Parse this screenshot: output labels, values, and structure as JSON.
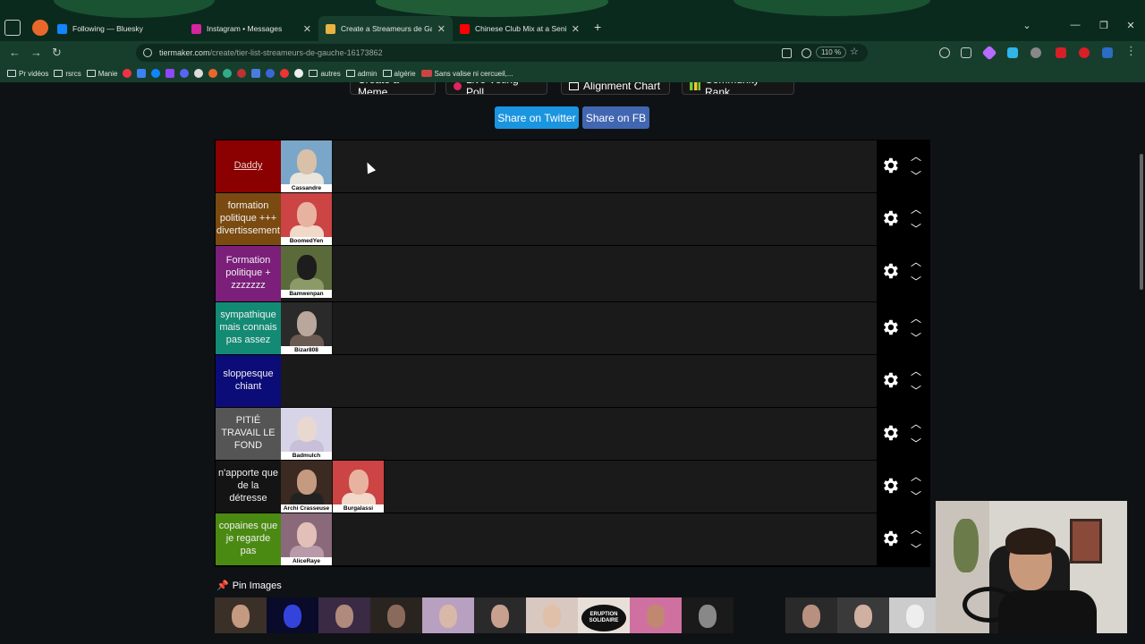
{
  "browser": {
    "tabs": [
      {
        "title": "Following — Bluesky",
        "color": "#1185fe"
      },
      {
        "title": "Instagram • Messages",
        "color": "#d6249f"
      },
      {
        "title": "Create a Streameurs de Gauche",
        "color": "#e8b341",
        "active": true
      },
      {
        "title": "Chinese Club Mix at a Senior",
        "color": "#ff0000"
      }
    ],
    "url_host": "tiermaker.com",
    "url_path": "/create/tier-list-streameurs-de-gauche-16173862",
    "zoom": "110 %",
    "bookmarks": [
      "Pr vidéos",
      "rsrcs",
      "Manie",
      "autres",
      "admin",
      "algérie",
      "Sans valise ni cercueil,..."
    ]
  },
  "page": {
    "top_buttons": [
      "Create a Meme",
      "Live Voting Poll",
      "Alignment Chart",
      "Community Rank"
    ],
    "share_twitter": "Share on Twitter",
    "share_fb": "Share on FB",
    "pin_label": "Pin Images"
  },
  "tiers": [
    {
      "label": "Daddy",
      "color": "#8b0000",
      "items": [
        "Cassandre"
      ]
    },
    {
      "label": "formation politique +++ divertissement",
      "color": "#7a4a10",
      "items": [
        "BoomedYen"
      ]
    },
    {
      "label": "Formation politique + zzzzzzz",
      "color": "#7b1f7b",
      "items": [
        "Bamwenpan"
      ]
    },
    {
      "label": "sympathique mais connais pas assez",
      "color": "#138a74",
      "items": [
        "Bizar808"
      ]
    },
    {
      "label": "sloppesque chiant",
      "color": "#0c0c78",
      "items": []
    },
    {
      "label": "PITIÉ TRAVAIL LE FOND",
      "color": "#555555",
      "items": [
        "Badmulch"
      ]
    },
    {
      "label": "n'apporte que de la détresse",
      "color": "#141414",
      "items": [
        "Archi Crasseuse",
        "Burgalassi"
      ]
    },
    {
      "label": "copaines que je regarde pas",
      "color": "#4a8a12",
      "items": [
        "AliceRaye"
      ]
    }
  ],
  "pool_caption": "ERUPTION SOLIDAIRE"
}
